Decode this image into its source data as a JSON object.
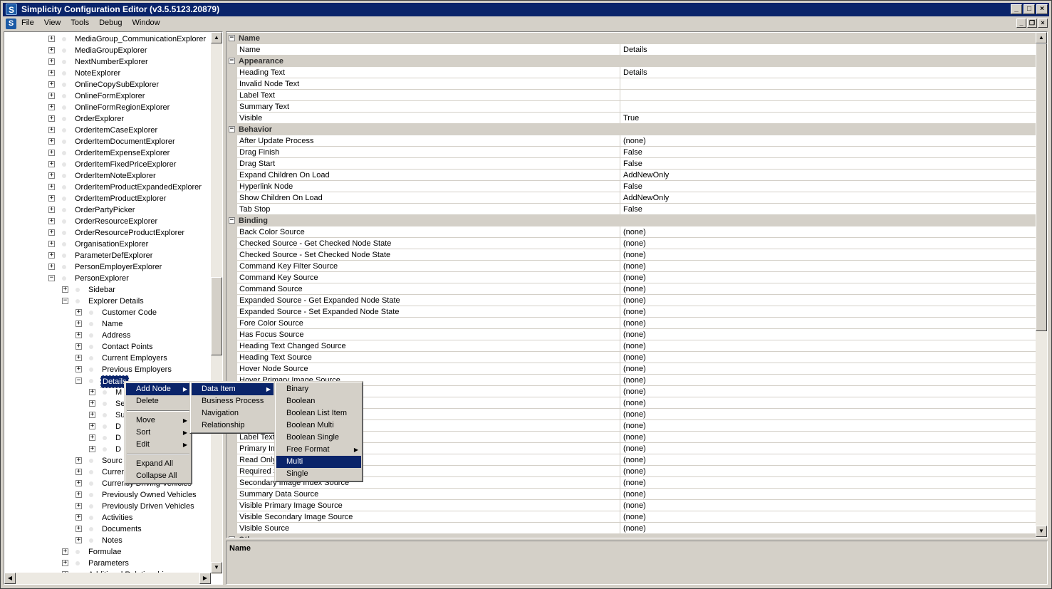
{
  "window": {
    "title": "Simplicity Configuration Editor (v3.5.5123.20879)",
    "app_icon": "S"
  },
  "menubar": {
    "items": [
      "File",
      "View",
      "Tools",
      "Debug",
      "Window"
    ]
  },
  "tree": {
    "items": [
      {
        "label": "MediaGroup_CommunicationExplorer",
        "level": 0,
        "expanded": false
      },
      {
        "label": "MediaGroupExplorer",
        "level": 0,
        "expanded": false
      },
      {
        "label": "NextNumberExplorer",
        "level": 0,
        "expanded": false
      },
      {
        "label": "NoteExplorer",
        "level": 0,
        "expanded": false
      },
      {
        "label": "OnlineCopySubExplorer",
        "level": 0,
        "expanded": false
      },
      {
        "label": "OnlineFormExplorer",
        "level": 0,
        "expanded": false
      },
      {
        "label": "OnlineFormRegionExplorer",
        "level": 0,
        "expanded": false
      },
      {
        "label": "OrderExplorer",
        "level": 0,
        "expanded": false
      },
      {
        "label": "OrderItemCaseExplorer",
        "level": 0,
        "expanded": false
      },
      {
        "label": "OrderItemDocumentExplorer",
        "level": 0,
        "expanded": false
      },
      {
        "label": "OrderItemExpenseExplorer",
        "level": 0,
        "expanded": false
      },
      {
        "label": "OrderItemFixedPriceExplorer",
        "level": 0,
        "expanded": false
      },
      {
        "label": "OrderItemNoteExplorer",
        "level": 0,
        "expanded": false
      },
      {
        "label": "OrderItemProductExpandedExplorer",
        "level": 0,
        "expanded": false
      },
      {
        "label": "OrderItemProductExplorer",
        "level": 0,
        "expanded": false
      },
      {
        "label": "OrderPartyPicker",
        "level": 0,
        "expanded": false
      },
      {
        "label": "OrderResourceExplorer",
        "level": 0,
        "expanded": false
      },
      {
        "label": "OrderResourceProductExplorer",
        "level": 0,
        "expanded": false
      },
      {
        "label": "OrganisationExplorer",
        "level": 0,
        "expanded": false
      },
      {
        "label": "ParameterDefExplorer",
        "level": 0,
        "expanded": false
      },
      {
        "label": "PersonEmployerExplorer",
        "level": 0,
        "expanded": false
      },
      {
        "label": "PersonExplorer",
        "level": 0,
        "expanded": true
      },
      {
        "label": "Sidebar",
        "level": 1,
        "expanded": false
      },
      {
        "label": "Explorer Details",
        "level": 1,
        "expanded": true
      },
      {
        "label": "Customer Code",
        "level": 2,
        "expanded": false
      },
      {
        "label": "Name",
        "level": 2,
        "expanded": false
      },
      {
        "label": "Address",
        "level": 2,
        "expanded": false
      },
      {
        "label": "Contact Points",
        "level": 2,
        "expanded": false
      },
      {
        "label": "Current Employers",
        "level": 2,
        "expanded": false
      },
      {
        "label": "Previous Employers",
        "level": 2,
        "expanded": false
      },
      {
        "label": "Details",
        "level": 2,
        "expanded": true,
        "selected": true
      },
      {
        "label": "M",
        "level": 3,
        "expanded": false
      },
      {
        "label": "Se",
        "level": 3,
        "expanded": false
      },
      {
        "label": "Su",
        "level": 3,
        "expanded": false
      },
      {
        "label": "D",
        "level": 3,
        "expanded": false
      },
      {
        "label": "D",
        "level": 3,
        "expanded": false
      },
      {
        "label": "D",
        "level": 3,
        "expanded": false
      },
      {
        "label": "Sourc",
        "level": 2,
        "expanded": false
      },
      {
        "label": "Curren",
        "level": 2,
        "expanded": false
      },
      {
        "label": "Currently Driving Vehicles",
        "level": 2,
        "expanded": false
      },
      {
        "label": "Previously Owned Vehicles",
        "level": 2,
        "expanded": false
      },
      {
        "label": "Previously Driven Vehicles",
        "level": 2,
        "expanded": false
      },
      {
        "label": "Activities",
        "level": 2,
        "expanded": false
      },
      {
        "label": "Documents",
        "level": 2,
        "expanded": false
      },
      {
        "label": "Notes",
        "level": 2,
        "expanded": false
      },
      {
        "label": "Formulae",
        "level": 1,
        "expanded": false
      },
      {
        "label": "Parameters",
        "level": 1,
        "expanded": false
      },
      {
        "label": "Additional Relationships",
        "level": 1,
        "expanded": false
      }
    ]
  },
  "grid": {
    "rows": [
      {
        "type": "category",
        "name": "Name"
      },
      {
        "name": "Name",
        "value": "Details"
      },
      {
        "type": "category",
        "name": "Appearance"
      },
      {
        "name": "Heading Text",
        "value": "Details"
      },
      {
        "name": "Invalid Node Text",
        "value": ""
      },
      {
        "name": "Label Text",
        "value": ""
      },
      {
        "name": "Summary Text",
        "value": ""
      },
      {
        "name": "Visible",
        "value": "True"
      },
      {
        "type": "category",
        "name": "Behavior"
      },
      {
        "name": "After Update Process",
        "value": "(none)"
      },
      {
        "name": "Drag Finish",
        "value": "False"
      },
      {
        "name": "Drag Start",
        "value": "False"
      },
      {
        "name": "Expand Children On Load",
        "value": "AddNewOnly"
      },
      {
        "name": "Hyperlink Node",
        "value": "False"
      },
      {
        "name": "Show Children On Load",
        "value": "AddNewOnly"
      },
      {
        "name": "Tab Stop",
        "value": "False"
      },
      {
        "type": "category",
        "name": "Binding"
      },
      {
        "name": "Back Color Source",
        "value": "(none)"
      },
      {
        "name": "Checked Source - Get Checked Node State",
        "value": "(none)"
      },
      {
        "name": "Checked Source - Set Checked Node State",
        "value": "(none)"
      },
      {
        "name": "Command Key Filter Source",
        "value": "(none)"
      },
      {
        "name": "Command Key Source",
        "value": "(none)"
      },
      {
        "name": "Command Source",
        "value": "(none)"
      },
      {
        "name": "Expanded Source - Get Expanded Node State",
        "value": "(none)"
      },
      {
        "name": "Expanded Source - Set Expanded Node State",
        "value": "(none)"
      },
      {
        "name": "Fore Color Source",
        "value": "(none)"
      },
      {
        "name": "Has Focus Source",
        "value": "(none)"
      },
      {
        "name": "Heading Text Changed Source",
        "value": "(none)"
      },
      {
        "name": "Heading Text Source",
        "value": "(none)"
      },
      {
        "name": "Hover Node Source",
        "value": "(none)"
      },
      {
        "name": "Hover Primary Image Source",
        "value": "(none)"
      },
      {
        "name": "",
        "value": "(none)"
      },
      {
        "name": "",
        "value": "(none)"
      },
      {
        "name": "",
        "value": "(none)"
      },
      {
        "name": "",
        "value": "(none)"
      },
      {
        "name": "Label Text",
        "value": "(none)"
      },
      {
        "name": "Primary Im",
        "value": "(none)"
      },
      {
        "name": "Read Only",
        "value": "(none)"
      },
      {
        "name": "Required S",
        "value": "(none)"
      },
      {
        "name": "Secondary Image Index Source",
        "value": "(none)"
      },
      {
        "name": "Summary Data Source",
        "value": "(none)"
      },
      {
        "name": "Visible Primary Image Source",
        "value": "(none)"
      },
      {
        "name": "Visible Secondary Image Source",
        "value": "(none)"
      },
      {
        "name": "Visible Source",
        "value": "(none)"
      },
      {
        "type": "category",
        "name": "Other"
      }
    ]
  },
  "description": {
    "title": "Name"
  },
  "context_menu": {
    "items": [
      {
        "label": "Add Node",
        "submenu": true,
        "highlight": true
      },
      {
        "label": "Delete"
      },
      {
        "sep": true
      },
      {
        "label": "Move",
        "submenu": true
      },
      {
        "label": "Sort",
        "submenu": true
      },
      {
        "label": "Edit",
        "submenu": true
      },
      {
        "sep": true
      },
      {
        "label": "Expand All"
      },
      {
        "label": "Collapse All"
      }
    ]
  },
  "submenu_add_node": {
    "items": [
      {
        "label": "Data Item",
        "submenu": true,
        "highlight": true
      },
      {
        "label": "Business Process"
      },
      {
        "label": "Navigation"
      },
      {
        "label": "Relationship"
      }
    ]
  },
  "submenu_data_item": {
    "items": [
      {
        "label": "Binary"
      },
      {
        "label": "Boolean"
      },
      {
        "label": "Boolean List Item"
      },
      {
        "label": "Boolean Multi"
      },
      {
        "label": "Boolean Single"
      },
      {
        "label": "Free Format",
        "submenu": true
      },
      {
        "label": "Multi",
        "highlight": true
      },
      {
        "label": "Single"
      }
    ]
  },
  "colors": {
    "title_bg": "#0a246a",
    "face": "#d4d0c8",
    "highlight": "#0a246a"
  }
}
